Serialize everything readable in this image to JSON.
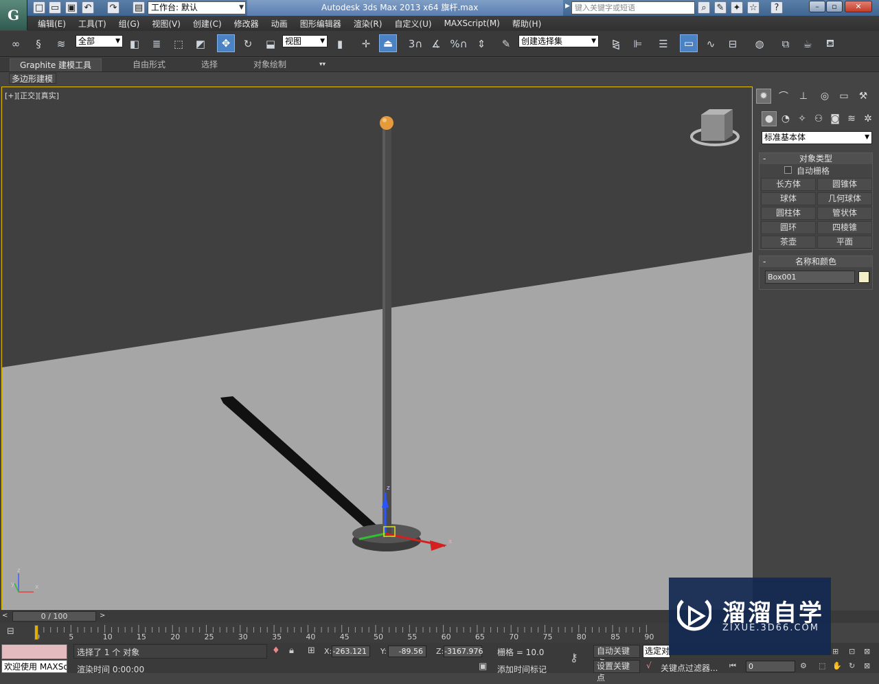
{
  "titlebar": {
    "logo_text": "G",
    "workspace_label": "工作台: 默认",
    "app_title": "Autodesk 3ds Max  2013 x64      旗杆.max",
    "search_placeholder": "键入关键字或短语",
    "quick_icons": [
      "new-icon",
      "open-icon",
      "save-icon",
      "undo-icon",
      "redo-icon",
      "project-folder-icon"
    ],
    "help_icons": [
      "binoculars-icon",
      "tools-icon",
      "communication-icon",
      "star-icon",
      "help-icon"
    ]
  },
  "menubar": {
    "items": [
      "编辑(E)",
      "工具(T)",
      "组(G)",
      "视图(V)",
      "创建(C)",
      "修改器",
      "动画",
      "图形编辑器",
      "渲染(R)",
      "自定义(U)",
      "MAXScript(M)",
      "帮助(H)"
    ]
  },
  "toolbar": {
    "selection_filter": "全部",
    "ref_coord": "视图",
    "named_selection": "创建选择集",
    "snap_labels": [
      "3",
      "%"
    ]
  },
  "ribbon": {
    "tabs": [
      "Graphite 建模工具",
      "自由形式",
      "选择",
      "对象绘制"
    ],
    "active_tab": "Graphite 建模工具",
    "sub_panel": "多边形建模"
  },
  "viewport": {
    "label": "[+][正交][真实]",
    "axis_x": "x",
    "axis_y": "y",
    "axis_z": "z",
    "gizmo_x": "x",
    "gizmo_z": "z"
  },
  "command_panel": {
    "category": "标准基本体",
    "object_type": {
      "title": "对象类型",
      "autogrid_label": "自动栅格",
      "buttons": [
        "长方体",
        "圆锥体",
        "球体",
        "几何球体",
        "圆柱体",
        "管状体",
        "圆环",
        "四棱锥",
        "茶壶",
        "平面"
      ]
    },
    "name_color": {
      "title": "名称和颜色",
      "name": "Box001",
      "color": "#f3f0c8"
    }
  },
  "timeline": {
    "slider_text": "0 / 100",
    "ticks": [
      "0",
      "5",
      "10",
      "15",
      "20",
      "25",
      "30",
      "35",
      "40",
      "45",
      "50",
      "55",
      "60",
      "65",
      "70",
      "75",
      "80",
      "85",
      "90"
    ]
  },
  "status": {
    "maxscript_text": "欢迎使用 MAXScr",
    "selection_status": "选择了 1 个 对象",
    "render_time": "渲染时间  0:00:00",
    "x_label": "X:",
    "x_value": "-263.121",
    "y_label": "Y:",
    "y_value": "-89.56",
    "z_label": "Z:",
    "z_value": "-3167.976",
    "grid": "栅格 = 10.0",
    "add_time_tag": "添加时间标记",
    "auto_key": "自动关键点",
    "set_key": "设置关键点",
    "selected_dd": "选定对",
    "key_filters": "关键点过滤器...",
    "frame_value": "0"
  },
  "watermark": {
    "title": "溜溜自学",
    "url": "ZIXUE.3D66.COM"
  }
}
